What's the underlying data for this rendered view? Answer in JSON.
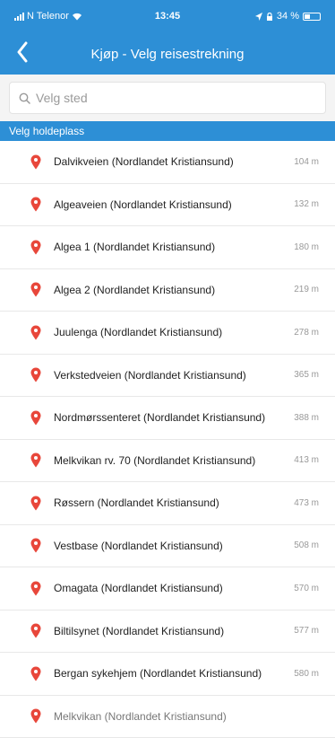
{
  "status_bar": {
    "carrier": "N Telenor",
    "time": "13:45",
    "battery": "34 %"
  },
  "nav": {
    "back_icon": "chevron-left-icon",
    "title": "Kjøp - Velg reisestrekning"
  },
  "search": {
    "placeholder": "Velg sted",
    "value": ""
  },
  "section": {
    "label": "Velg holdeplass"
  },
  "colors": {
    "brand_blue": "#2d8fd6",
    "pin_red": "#e8473b"
  },
  "stops": [
    {
      "name": "Dalvikveien (Nordlandet Kristiansund)",
      "distance": "104 m"
    },
    {
      "name": "Algeaveien (Nordlandet Kristiansund)",
      "distance": "132 m"
    },
    {
      "name": "Algea 1 (Nordlandet Kristiansund)",
      "distance": "180 m"
    },
    {
      "name": "Algea 2 (Nordlandet Kristiansund)",
      "distance": "219 m"
    },
    {
      "name": "Juulenga (Nordlandet Kristiansund)",
      "distance": "278 m"
    },
    {
      "name": "Verkstedveien (Nordlandet Kristiansund)",
      "distance": "365 m"
    },
    {
      "name": "Nordmørssenteret (Nordlandet Kristiansund)",
      "distance": "388 m"
    },
    {
      "name": "Melkvikan rv. 70 (Nordlandet Kristiansund)",
      "distance": "413 m"
    },
    {
      "name": "Røssern (Nordlandet Kristiansund)",
      "distance": "473 m"
    },
    {
      "name": "Vestbase (Nordlandet Kristiansund)",
      "distance": "508 m"
    },
    {
      "name": "Omagata (Nordlandet Kristiansund)",
      "distance": "570 m"
    },
    {
      "name": "Biltilsynet (Nordlandet Kristiansund)",
      "distance": "577 m"
    },
    {
      "name": "Bergan sykehjem (Nordlandet Kristiansund)",
      "distance": "580 m"
    },
    {
      "name": "Melkvikan (Nordlandet Kristiansund)",
      "distance": ""
    }
  ]
}
